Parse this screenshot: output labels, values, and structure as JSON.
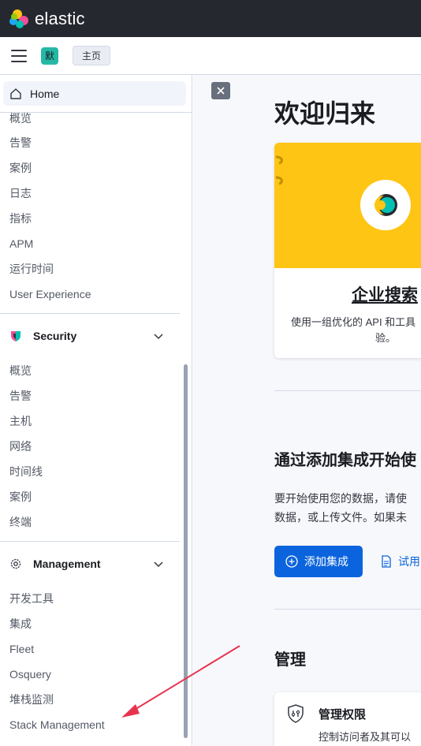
{
  "header": {
    "brand": "elastic"
  },
  "subbar": {
    "space_initial": "默",
    "breadcrumb": "主页"
  },
  "sidebar": {
    "home": "Home",
    "observability_items": [
      "概览",
      "告警",
      "案例",
      "日志",
      "指标",
      "APM",
      "运行时间",
      "User Experience"
    ],
    "security": {
      "title": "Security",
      "items": [
        "概览",
        "告警",
        "主机",
        "网络",
        "时间线",
        "案例",
        "终端"
      ]
    },
    "management": {
      "title": "Management",
      "items": [
        "开发工具",
        "集成",
        "Fleet",
        "Osquery",
        "堆栈监测",
        "Stack Management"
      ]
    }
  },
  "main": {
    "title": "欢迎归来",
    "card": {
      "title": "企业搜索",
      "desc_line1": "使用一组优化的 API 和工具",
      "desc_line2": "验。"
    },
    "integrations": {
      "title": "通过添加集成开始使",
      "para_line1": "要开始使用您的数据，请使",
      "para_line2": "数据，或上传文件。如果未",
      "add_button": "添加集成",
      "try_link": "试用"
    },
    "management": {
      "title": "管理",
      "card_title": "管理权限",
      "card_desc": "控制访问者及其可以"
    }
  },
  "colors": {
    "header_bg": "#25282f",
    "primary": "#0b64dd",
    "card_yellow": "#fec514",
    "annotation_arrow": "#e8334f"
  }
}
